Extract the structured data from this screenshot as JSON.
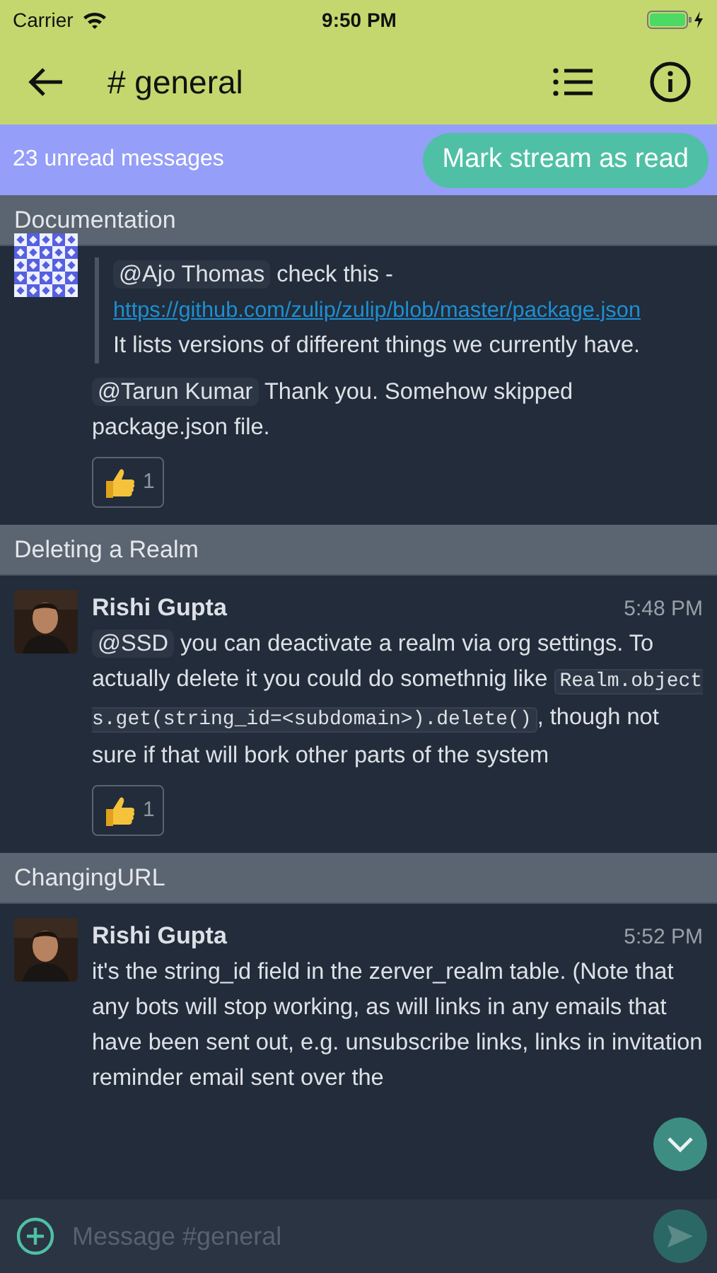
{
  "status_bar": {
    "carrier": "Carrier",
    "time": "9:50 PM",
    "charging": true
  },
  "header": {
    "title": "# general"
  },
  "unread_banner": {
    "text": "23 unread messages",
    "button": "Mark stream as read"
  },
  "topics": [
    {
      "title": "Documentation",
      "messages": [
        {
          "avatar": {
            "kind": "identicon"
          },
          "blocks": [
            {
              "kind": "quote",
              "paragraphs": [
                [
                  {
                    "kind": "mention",
                    "text": "@Ajo Thomas"
                  },
                  {
                    "kind": "text",
                    "text": " check this - "
                  },
                  {
                    "kind": "link",
                    "text": "https://github.com/zulip/zulip/blob/master/package.json"
                  }
                ],
                [
                  {
                    "kind": "text",
                    "text": "It lists versions of different things we currently have."
                  }
                ]
              ]
            },
            {
              "kind": "paragraph",
              "segments": [
                {
                  "kind": "mention",
                  "text": "@Tarun Kumar"
                },
                {
                  "kind": "text",
                  "text": " Thank you. Somehow skipped package.json file."
                }
              ]
            }
          ],
          "reactions": [
            {
              "count": "1"
            }
          ]
        }
      ]
    },
    {
      "title": "Deleting a Realm",
      "messages": [
        {
          "avatar": {
            "kind": "picture"
          },
          "sender": "Rishi Gupta",
          "time": "5:48 PM",
          "blocks": [
            {
              "kind": "paragraph",
              "segments": [
                {
                  "kind": "mention",
                  "text": "@SSD"
                },
                {
                  "kind": "text",
                  "text": " you can deactivate a realm via org settings. To actually delete it you could do somethnig like "
                },
                {
                  "kind": "code",
                  "text": "Realm.objects.get(string_id=<subdomain>).delete()"
                },
                {
                  "kind": "text",
                  "text": ", though not sure if that will bork other parts of the system"
                }
              ]
            }
          ],
          "reactions": [
            {
              "count": "1"
            }
          ]
        }
      ]
    },
    {
      "title": "ChangingURL",
      "messages": [
        {
          "avatar": {
            "kind": "picture"
          },
          "sender": "Rishi Gupta",
          "time": "5:52 PM",
          "blocks": [
            {
              "kind": "paragraph",
              "segments": [
                {
                  "kind": "text",
                  "text": "it's the string_id field in the zerver_realm table. (Note that any bots will stop working, as will links in any emails that have been sent out, e.g. unsubscribe links, links in invitation reminder email sent over the"
                }
              ]
            }
          ]
        }
      ]
    }
  ],
  "composer": {
    "placeholder": "Message #general",
    "send_disabled": true
  }
}
